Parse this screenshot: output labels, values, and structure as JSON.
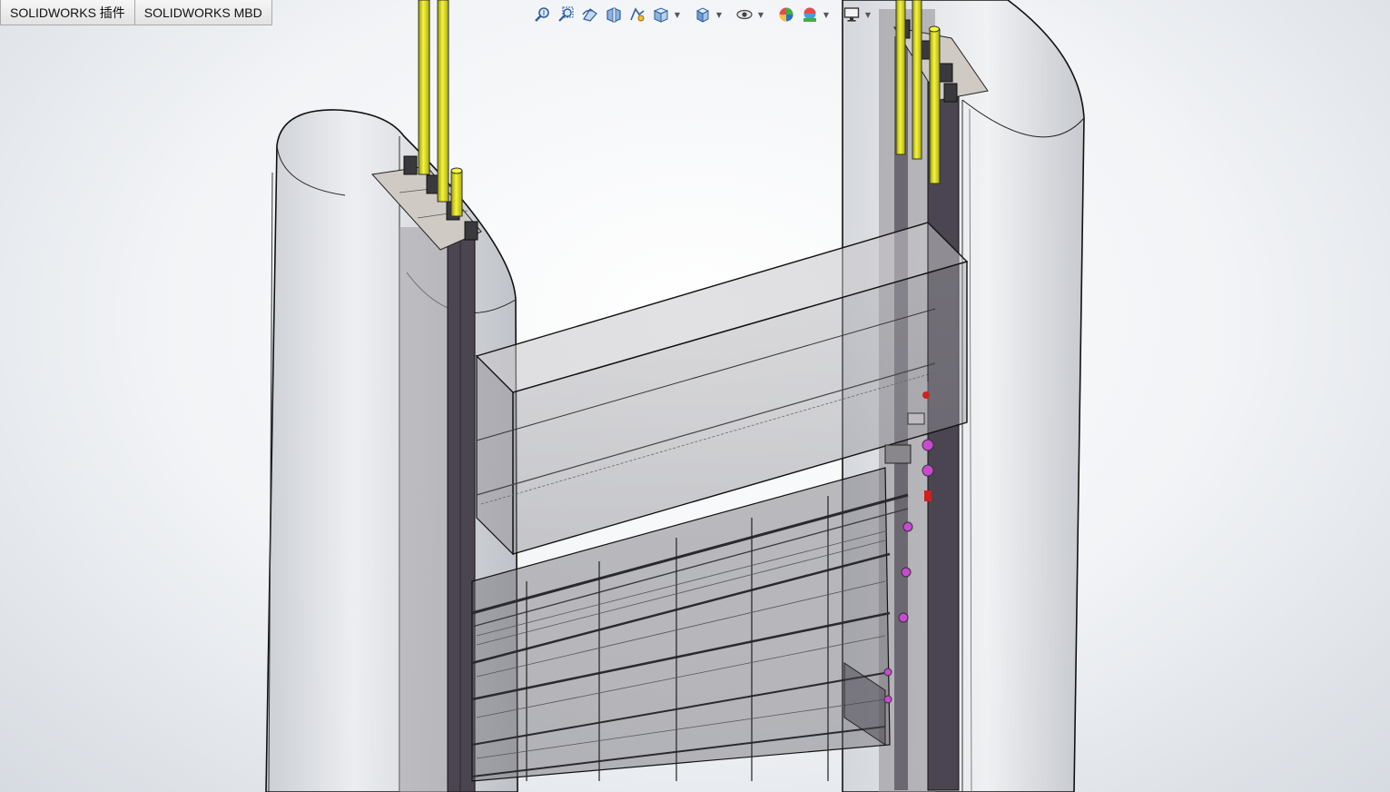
{
  "tabs": [
    {
      "label": "SOLIDWORKS 插件"
    },
    {
      "label": "SOLIDWORKS MBD"
    }
  ],
  "toolbar": {
    "icons": [
      "zoom-to-fit-icon",
      "zoom-to-area-icon",
      "previous-view-icon",
      "section-view-icon",
      "dynamic-annotation-icon",
      "view-orientation-icon",
      "display-style-icon",
      "hide-show-items-icon",
      "edit-appearance-icon",
      "apply-scene-icon",
      "view-settings-icon"
    ]
  },
  "colors": {
    "pipe": "#e6e619",
    "pillar": "#d9dbe0",
    "gate_frame": "#4a4550",
    "plate": "#cfcac4",
    "accent_magenta": "#c84ad0",
    "accent_red": "#d02020"
  }
}
